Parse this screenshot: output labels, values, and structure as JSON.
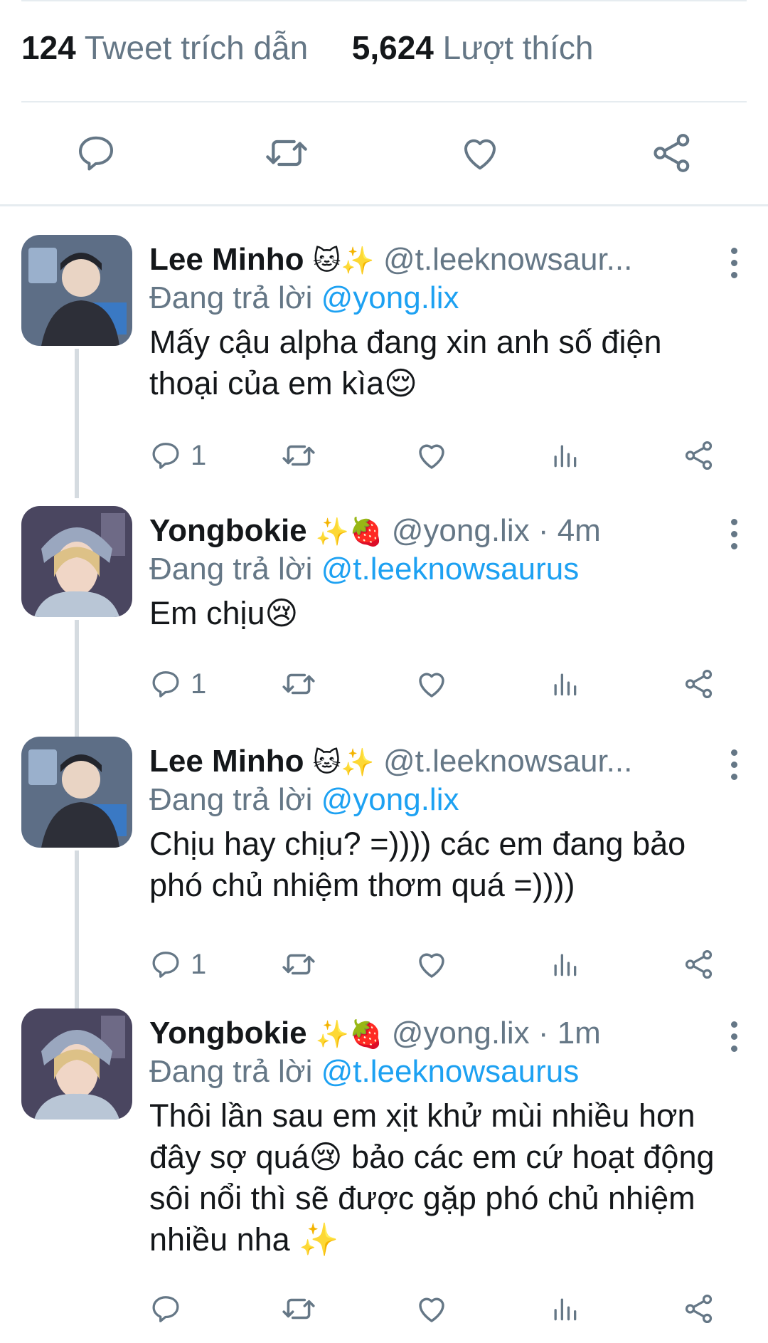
{
  "stats": {
    "quotes_count": "124",
    "quotes_label": "Tweet trích dẫn",
    "likes_count": "5,624",
    "likes_label": "Lượt thích"
  },
  "icons": {
    "reply": "reply-icon",
    "retweet": "retweet-icon",
    "like": "heart-icon",
    "views": "analytics-icon",
    "share": "share-icon",
    "more": "more-vertical-icon"
  },
  "colors": {
    "mention": "#1da1f2",
    "muted": "#657786",
    "text": "#14171a"
  },
  "replying_prefix": "Đang trả lời",
  "tweets": [
    {
      "name": "Lee Minho",
      "emoji": "🐱✨",
      "handle": "@t.leeknowsaur...",
      "reply_to": "@yong.lix",
      "text": "Mấy cậu alpha đang xin anh số điện thoại của em kìa😌",
      "reply_count": "1"
    },
    {
      "name": "Yongbokie",
      "emoji": "✨🍓",
      "handle": "@yong.lix · 4m",
      "reply_to": "@t.leeknowsaurus",
      "text": "Em chịu😢",
      "reply_count": "1"
    },
    {
      "name": "Lee Minho",
      "emoji": "🐱✨",
      "handle": "@t.leeknowsaur...",
      "reply_to": "@yong.lix",
      "text": "Chịu hay chịu? =)))) các em đang bảo phó chủ nhiệm thơm quá =))))",
      "reply_count": "1"
    },
    {
      "name": "Yongbokie",
      "emoji": "✨🍓",
      "handle": "@yong.lix · 1m",
      "reply_to": "@t.leeknowsaurus",
      "text": "Thôi lần sau em xịt khử mùi nhiều hơn đây sợ quá😢 bảo các em cứ hoạt động sôi nổi thì sẽ được gặp phó chủ nhiệm nhiều nha ✨",
      "reply_count": ""
    }
  ]
}
